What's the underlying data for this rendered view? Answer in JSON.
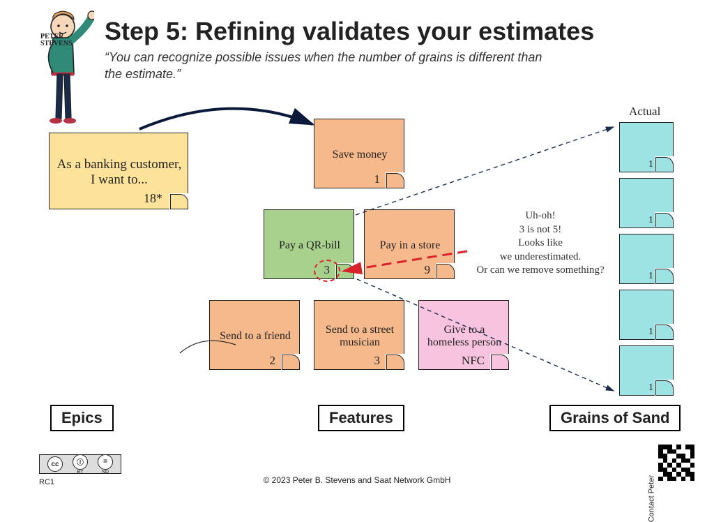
{
  "header": {
    "title": "Step 5: Refining validates your estimates",
    "subtitle": "“You can recognize possible issues when the number of grains is different than the estimate.”",
    "author_name": "PETER STEVENS"
  },
  "epic": {
    "text": "As a banking customer, I want to...",
    "estimate": "18*"
  },
  "features": {
    "save_money": {
      "text": "Save money",
      "estimate": "1"
    },
    "pay_qr": {
      "text": "Pay a QR-bill",
      "estimate": "3"
    },
    "pay_store": {
      "text": "Pay in a store",
      "estimate": "9"
    },
    "send_friend": {
      "text": "Send to a friend",
      "estimate": "2"
    },
    "send_musician": {
      "text": "Send to a street musician",
      "estimate": "3"
    },
    "homeless": {
      "text": "Give to a homeless person",
      "estimate": "NFC"
    }
  },
  "actual_label": "Actual",
  "grains": [
    {
      "value": "1"
    },
    {
      "value": "1"
    },
    {
      "value": "1"
    },
    {
      "value": "1"
    },
    {
      "value": "1"
    }
  ],
  "annotations": {
    "uhoh": "Uh-oh!\n3 is not 5!\nLooks like\nwe underestimated.\nOr can we remove something?"
  },
  "sections": {
    "epics": "Epics",
    "features": "Features",
    "grains": "Grains of Sand"
  },
  "footer": {
    "license_badges": [
      "cc",
      "ⓘ",
      "="
    ],
    "license_sub": [
      "BY",
      "ND"
    ],
    "rc": "RC1",
    "copyright": "© 2023 Peter B. Stevens and Saat Network GmbH",
    "contact": "Contact Peter"
  }
}
